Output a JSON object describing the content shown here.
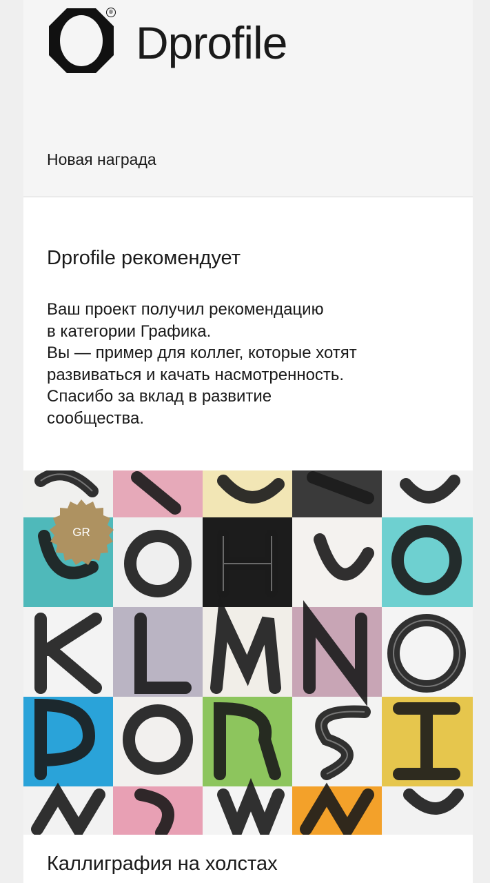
{
  "brand": {
    "name": "Dprofile",
    "reg_mark": "®"
  },
  "notification": {
    "label": "Новая награда"
  },
  "recommendation": {
    "title": "Dprofile рекомендует",
    "lines": [
      "Ваш проект получил рекомендацию",
      "в категории Графика.",
      "Вы — пример для коллег, которые хотят",
      "развиваться и качать насмотренность.",
      "Спасибо за вклад в развитие",
      "сообщества."
    ]
  },
  "project": {
    "badge": "GR",
    "title": "Каллиграфия на холстах",
    "badge_color": "#ae9261"
  },
  "colors": {
    "page_bg": "#efefef",
    "header_bg": "#f5f5f5",
    "card_bg": "#ffffff",
    "text": "#1a1a1a"
  }
}
